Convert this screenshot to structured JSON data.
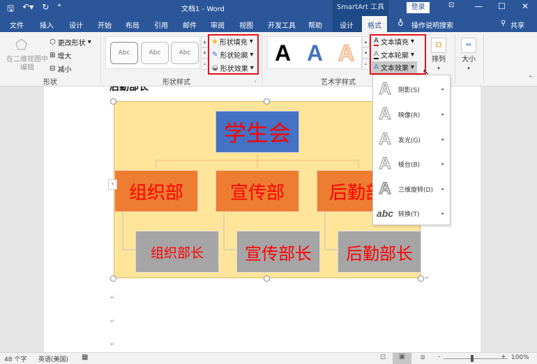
{
  "titlebar": {
    "doc_title": "文档1 - Word",
    "context_tool": "SmartArt 工具",
    "login_label": "登录",
    "qat": {
      "save": "save-icon",
      "undo": "undo-icon",
      "redo": "redo-icon",
      "customize": "customize-icon"
    },
    "window": {
      "ribbon_display": "ribbon-display-icon",
      "minimize": "—",
      "maximize": "☐",
      "close": "✕"
    }
  },
  "tabs": [
    {
      "label": "文件"
    },
    {
      "label": "插入"
    },
    {
      "label": "设计"
    },
    {
      "label": "开始"
    },
    {
      "label": "布局"
    },
    {
      "label": "引用"
    },
    {
      "label": "邮件"
    },
    {
      "label": "审阅"
    },
    {
      "label": "视图"
    },
    {
      "label": "开发工具"
    },
    {
      "label": "帮助"
    },
    {
      "label": "设计"
    },
    {
      "label": "格式"
    }
  ],
  "tell_me": "操作说明搜索",
  "share": "共享",
  "ribbon": {
    "shapes_group": {
      "label": "形状",
      "edit_2d": "在二维视图中编辑",
      "edit_2d_line1": "在二维视图中",
      "edit_2d_line2": "编辑",
      "change_shape": "更改形状",
      "larger": "增大",
      "smaller": "减小"
    },
    "shape_styles": {
      "label": "形状样式",
      "samples": [
        "Abc",
        "Abc",
        "Abc"
      ],
      "fill": "形状填充",
      "outline": "形状轮廓",
      "effects": "形状效果"
    },
    "wordart_styles": {
      "label": "艺术字样式",
      "samples": [
        {
          "glyph": "A",
          "color": "#000000"
        },
        {
          "glyph": "A",
          "color": "#4472c4"
        },
        {
          "glyph": "A",
          "color": "#f4b183"
        }
      ],
      "text_fill": "文本填充",
      "text_outline": "文本轮廓",
      "text_effects": "文本效果"
    },
    "arrange": {
      "label": "排列"
    },
    "size": {
      "label": "大小"
    }
  },
  "document": {
    "heading_partial": "后勤部长",
    "smartart": {
      "top": "学生会",
      "departments": [
        "组织部",
        "宣传部",
        "后勤部"
      ],
      "heads": [
        "组织部长",
        "宣传部长",
        "后勤部长"
      ],
      "colors": {
        "background": "#ffe599",
        "top": "#4472c4",
        "department": "#ed7d31",
        "head": "#a5a5a5",
        "text": "#ff0000",
        "connector": "#f4b183"
      }
    }
  },
  "text_effects_menu": [
    {
      "label": "阴影(S)",
      "icon": "shadow-a-icon"
    },
    {
      "label": "映像(R)",
      "icon": "reflection-a-icon"
    },
    {
      "label": "发光(G)",
      "icon": "glow-a-icon"
    },
    {
      "label": "棱台(B)",
      "icon": "bevel-a-icon"
    },
    {
      "label": "三维旋转(D)",
      "icon": "3d-rotation-a-icon"
    },
    {
      "label": "转换(T)",
      "icon": "transform-abc-icon"
    }
  ],
  "status": {
    "word_count": "48 个字",
    "language": "英语(美国)",
    "zoom_minus": "-",
    "zoom_plus": "+",
    "zoom_level": "100%"
  },
  "accent": {
    "ribbon_blue": "#2b579a",
    "highlight_red": "#e3111b"
  }
}
